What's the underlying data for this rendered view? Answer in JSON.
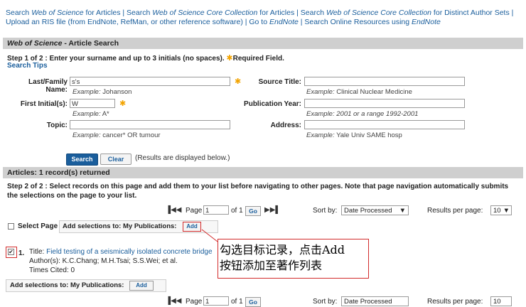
{
  "topnav": {
    "s1": "Search ",
    "s1i": "Web of Science",
    "s1b": " for Articles | Search ",
    "s2i": "Web of Science Core Collection",
    "s2b": " for Articles | Search ",
    "s3i": "Web of Science Core Collection",
    "s3b": " for Distinct Author Sets |",
    "l2a": "Upload an RIS file (from EndNote, RefMan, or other reference software) | Go to ",
    "l2ai": "EndNote",
    "l2b": " | Search Online Resources using ",
    "l2bi": "EndNote"
  },
  "header": {
    "title_italic": "Web of Science",
    "title_rest": " - Article Search"
  },
  "step1": {
    "text": "Step 1 of 2 : Enter your surname and up to 3 initials (no spaces).",
    "required": "Required Field.",
    "tips": "Search Tips"
  },
  "form": {
    "last_name": {
      "label": "Last/Family Name:",
      "value": "s's",
      "ex_label": "Example:",
      "ex_value": " Johanson"
    },
    "first_initials": {
      "label": "First Initial(s):",
      "value": "W",
      "ex_label": "Example:",
      "ex_value": " A*"
    },
    "topic": {
      "label": "Topic:",
      "value": "",
      "ex_label": "Example:",
      "ex_value": " cancer* OR tumour"
    },
    "source_title": {
      "label": "Source Title:",
      "value": "",
      "ex_label": "Example:",
      "ex_value": " Clinical Nuclear Medicine"
    },
    "pub_year": {
      "label": "Publication Year:",
      "value": "",
      "ex_label": "Example:",
      "ex_value": " 2001 or a range 1992-2001"
    },
    "address": {
      "label": "Address:",
      "value": "",
      "ex_label": "Example:",
      "ex_value": " Yale Univ SAME hosp"
    }
  },
  "buttons": {
    "search": "Search",
    "clear": "Clear",
    "note": "(Results are displayed below.)"
  },
  "results_bar": "Articles: 1 record(s) returned",
  "step2": "Step 2 of 2 : Select records on this page and add them to your list before navigating to other pages. Note that page navigation automatically submits the selections on the page to your list.",
  "pager": {
    "page_label": "Page",
    "page_value": "1",
    "of_label": "of 1",
    "go": "Go",
    "sortby": "Sort by:",
    "sort_value": "Date Processed",
    "rpp": "Results per page:",
    "rpp_value": "10"
  },
  "select_page": {
    "label": "Select Page",
    "add_label": "Add selections to: My Publications:",
    "add_btn": "Add"
  },
  "record": {
    "num": "1.",
    "title_label": "Title:",
    "title": "Field testing of a seismically isolated concrete bridge",
    "authors": "Author(s): K.C.Chang; M.H.Tsai; S.S.Wei; et al.",
    "cited": "Times Cited: 0"
  },
  "bottom_add": {
    "label": "Add selections to: My Publications:",
    "btn": "Add"
  },
  "annotation": {
    "line1": "勾选目标记录，点击Add",
    "line2": "按钮添加至著作列表"
  },
  "colors": {
    "link": "#1a5e9c",
    "bar": "#cfcfcf",
    "annot": "#d22b2b",
    "star": "#f2a300"
  }
}
